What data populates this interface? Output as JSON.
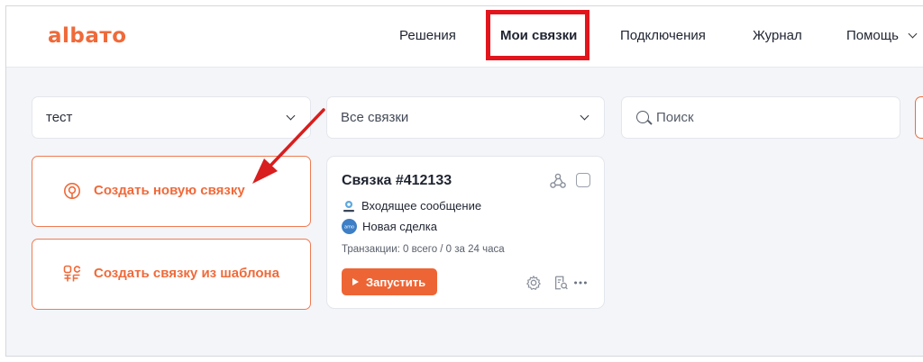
{
  "header": {
    "logo": "albaтo",
    "nav": [
      {
        "label": "Решения"
      },
      {
        "label": "Мои связки"
      },
      {
        "label": "Подключения"
      },
      {
        "label": "Журнал"
      },
      {
        "label": "Помощь"
      }
    ]
  },
  "filters": {
    "project": "тест",
    "bundles": "Все связки",
    "search_placeholder": "Поиск"
  },
  "actions": {
    "create_new": "Создать новую связку",
    "create_from_template": "Создать связку из шаблона"
  },
  "card": {
    "title": "Связка #412133",
    "trigger": "Входящее сообщение",
    "action": "Новая сделка",
    "action_icon_text": "amo",
    "transactions": "Транзакции: 0 всего / 0 за 24 часа",
    "run_label": "Запустить"
  },
  "colors": {
    "brand": "#ef6a3a",
    "highlight": "#e3151c",
    "arrow": "#d81e1e"
  }
}
